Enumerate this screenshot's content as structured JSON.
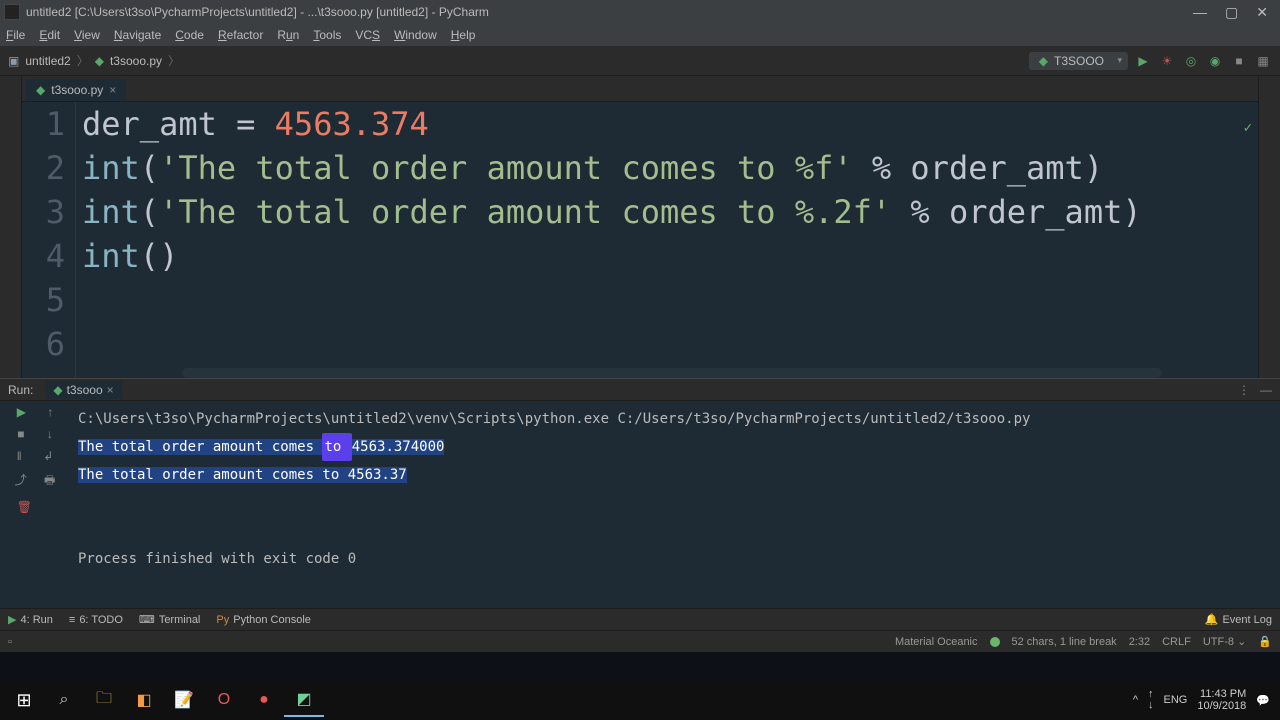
{
  "titlebar": {
    "text": "untitled2 [C:\\Users\\t3so\\PycharmProjects\\untitled2] - ...\\t3sooo.py [untitled2] - PyCharm"
  },
  "menu": [
    "File",
    "Edit",
    "View",
    "Navigate",
    "Code",
    "Refactor",
    "Run",
    "Tools",
    "VCS",
    "Window",
    "Help"
  ],
  "breadcrumb": {
    "root": "untitled2",
    "file": "t3sooo.py"
  },
  "run_config": "T3SOOO",
  "tab": {
    "name": "t3sooo.py"
  },
  "code": {
    "l1_ident": "der_amt",
    "l1_eq": " = ",
    "l1_num": "4563.374",
    "l2_func": "int",
    "l2_str": "'The total order amount comes to %f'",
    "l2_tail": " % order_amt)",
    "l3_func": "int",
    "l3_str": "'The total order amount comes to %.2f'",
    "l3_tail": " % order_amt)",
    "l4_func": "int",
    "l4_parens": "()"
  },
  "run": {
    "label": "Run:",
    "tab": "t3sooo",
    "path": "C:\\Users\\t3so\\PycharmProjects\\untitled2\\venv\\Scripts\\python.exe C:/Users/t3so/PycharmProjects/untitled2/t3sooo.py",
    "out1_a": "The total order amount comes ",
    "out1_b": "to ",
    "out1_c": "4563.374000",
    "out2": "The total order amount comes to 4563.37",
    "exit": "Process finished with exit code 0"
  },
  "bottom_tabs": {
    "run": "4: Run",
    "todo": "6: TODO",
    "terminal": "Terminal",
    "pyconsole": "Python Console",
    "eventlog": "Event Log"
  },
  "status": {
    "theme": "Material Oceanic",
    "sel": "52 chars, 1 line break",
    "pos": "2:32",
    "eol": "CRLF",
    "enc": "UTF-8",
    "lock": "🔒"
  },
  "tray": {
    "net_up": "↑",
    "net_dn": "↓",
    "lang": "ENG",
    "time": "11:43 PM",
    "date": "10/9/2018"
  }
}
